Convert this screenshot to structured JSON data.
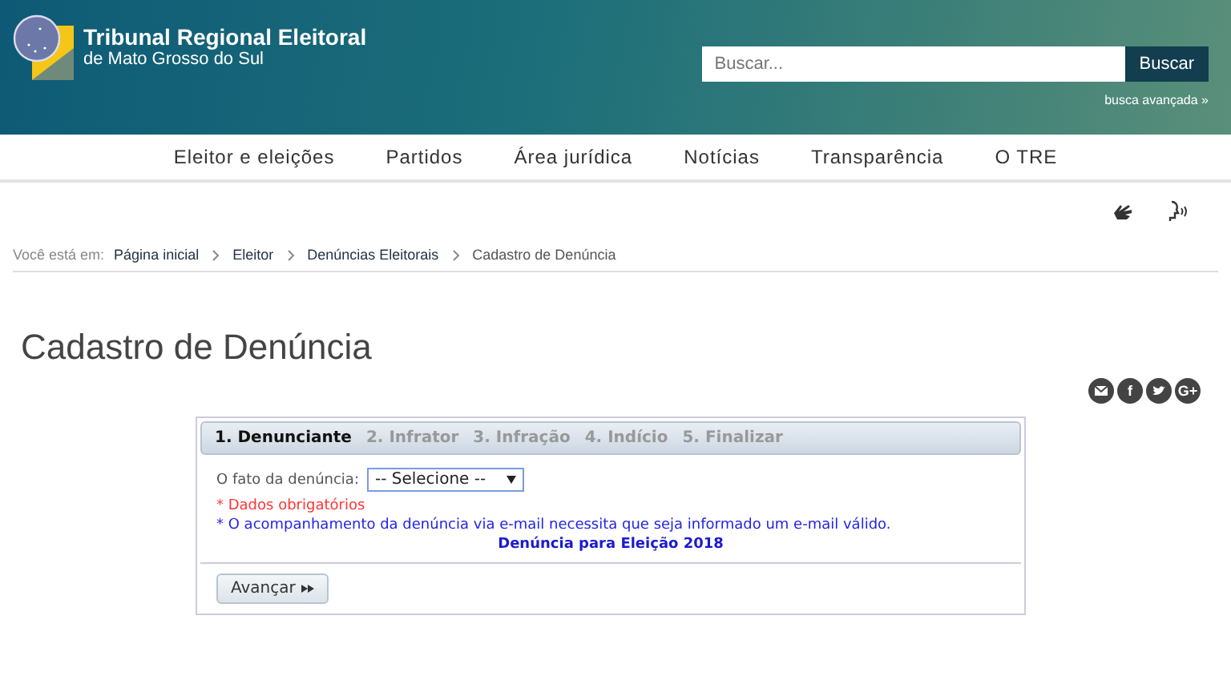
{
  "header": {
    "logo_title": "Tribunal Regional Eleitoral",
    "logo_subtitle": "de Mato Grosso do Sul",
    "search": {
      "placeholder": "Buscar..."
    },
    "search_button": "Buscar",
    "advanced_search": "busca avançada »"
  },
  "nav": [
    "Eleitor e eleições",
    "Partidos",
    "Área jurídica",
    "Notícias",
    "Transparência",
    "O TRE"
  ],
  "breadcrumb": {
    "prefix": "Você está em:",
    "items": [
      {
        "label": "Página inicial",
        "current": false
      },
      {
        "label": "Eleitor",
        "current": false
      },
      {
        "label": "Denúncias Eleitorais",
        "current": false
      },
      {
        "label": "Cadastro de Denúncia",
        "current": true
      }
    ]
  },
  "page_title": "Cadastro de Denúncia",
  "share": [
    {
      "kind": "email"
    },
    {
      "kind": "facebook",
      "glyph": "f"
    },
    {
      "kind": "twitter"
    },
    {
      "kind": "google",
      "glyph": "G+"
    }
  ],
  "form": {
    "steps": [
      {
        "label": "1. Denunciante",
        "selected": true
      },
      {
        "label": "2. Infrator",
        "selected": false
      },
      {
        "label": "3. Infração",
        "selected": false
      },
      {
        "label": "4. Indício",
        "selected": false
      },
      {
        "label": "5. Finalizar",
        "selected": false
      }
    ],
    "field_label": "O fato da denúncia:",
    "select_value": "-- Selecione --",
    "required_note": "* Dados obrigatórios",
    "email_note": "* O acompanhamento da denúncia via e-mail necessita que seja informado um e-mail válido.",
    "election_note": "Denúncia para Eleição 2018",
    "next_button": "Avançar"
  }
}
